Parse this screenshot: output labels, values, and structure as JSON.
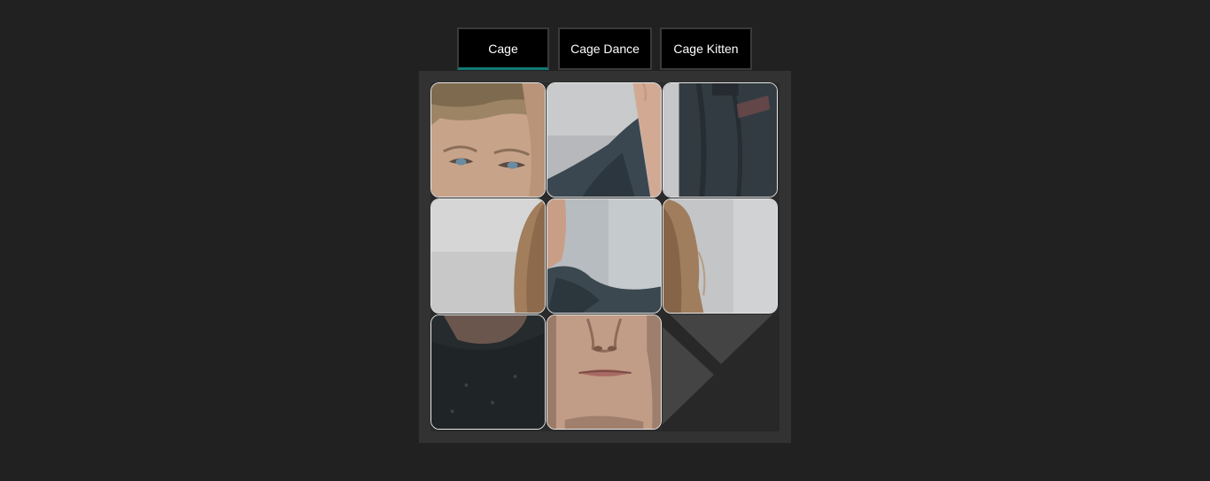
{
  "tabs": [
    {
      "label": "Cage",
      "active": true
    },
    {
      "label": "Cage Dance",
      "active": false
    },
    {
      "label": "Cage Kitten",
      "active": false
    }
  ],
  "puzzle": {
    "grid_size": 3,
    "empty_position": {
      "row": 3,
      "col": 3
    },
    "tiles": [
      {
        "row": 1,
        "col": 1,
        "content": "eyes-and-hair"
      },
      {
        "row": 1,
        "col": 2,
        "content": "ear-and-scarf"
      },
      {
        "row": 1,
        "col": 3,
        "content": "dark-scarf"
      },
      {
        "row": 2,
        "col": 1,
        "content": "hair-edge-left"
      },
      {
        "row": 2,
        "col": 2,
        "content": "neck-and-collar"
      },
      {
        "row": 2,
        "col": 3,
        "content": "hair-edge-right"
      },
      {
        "row": 3,
        "col": 1,
        "content": "chin-and-coat"
      },
      {
        "row": 3,
        "col": 2,
        "content": "nose-and-mouth"
      }
    ]
  },
  "colors": {
    "background": "#212121",
    "tab_background": "#000000",
    "tab_active_underline": "#137a74",
    "tile_border": "#e6e6e6",
    "board_frame": "#323232"
  }
}
